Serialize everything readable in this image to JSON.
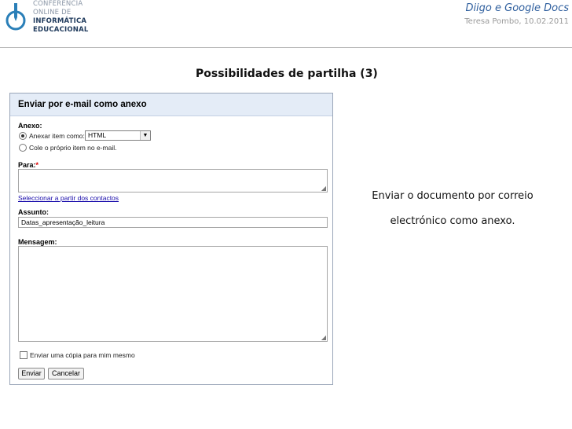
{
  "header": {
    "logo_lines": [
      "CONFERÊNCIA",
      "ONLINE DE",
      "INFORMÁTICA",
      "EDUCACIONAL"
    ],
    "title": "Diigo e Google Docs",
    "subtitle": "Teresa Pombo, 10.02.2011"
  },
  "slide": {
    "title": "Possibilidades de partilha (3)",
    "caption_line1": "Enviar o documento por correio",
    "caption_line2": "electrónico como anexo."
  },
  "form": {
    "title": "Enviar por e-mail como anexo",
    "attachment_label": "Anexo:",
    "option_attach": "Anexar item como:",
    "attach_format": "HTML",
    "option_paste": "Cole o próprio item no e-mail.",
    "to_label": "Para:",
    "required_mark": "*",
    "contacts_link": "Seleccionar a partir dos contactos",
    "subject_label": "Assunto:",
    "subject_value": "Datas_apresentação_leitura",
    "message_label": "Mensagem:",
    "copy_label": "Enviar uma cópia para mim mesmo",
    "send_button": "Enviar",
    "cancel_button": "Cancelar"
  }
}
